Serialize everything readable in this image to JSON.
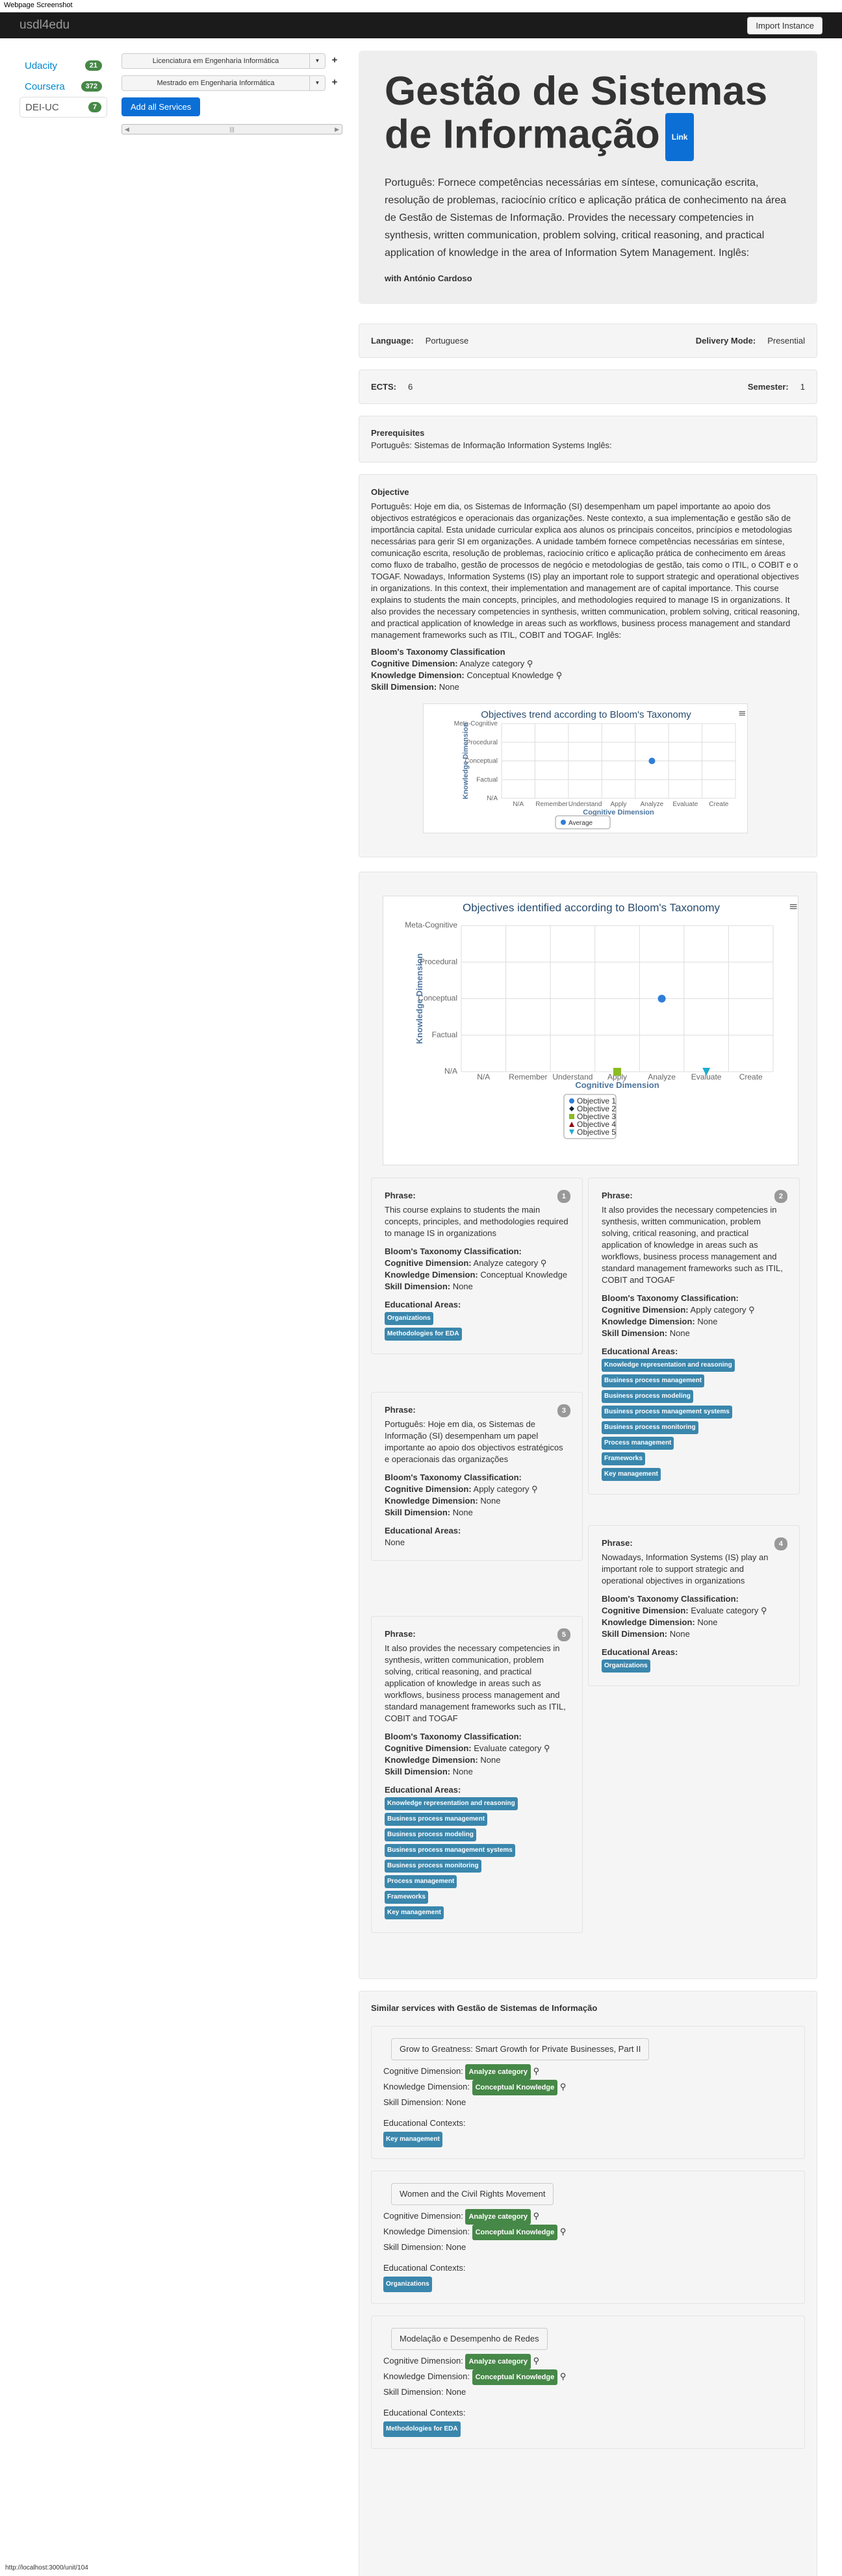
{
  "caption": "Webpage Screenshot",
  "nav": {
    "brand": "usdl4edu",
    "import": "Import Instance"
  },
  "sources": [
    {
      "label": "Udacity",
      "count": "21"
    },
    {
      "label": "Coursera",
      "count": "372"
    },
    {
      "label": "DEI-UC",
      "count": "7"
    }
  ],
  "services": [
    "Licenciatura em Engenharia Informática",
    "Mestrado em Engenharia Informática"
  ],
  "add_all": "Add all Services",
  "hero": {
    "title": "Gestão de Sistemas de Informação",
    "link": "Link",
    "desc": "Português: Fornece competências necessárias em síntese, comunicação escrita, resolução de problemas, raciocínio crítico e aplicação prática de conhecimento na área de Gestão de Sistemas de Informação. Provides the necessary competencies in synthesis, written communication, problem solving, critical reasoning, and practical application of knowledge in the area of Information Sytem Management. Inglês:",
    "with": "with António Cardoso"
  },
  "info": {
    "language_label": "Language:",
    "language": "Portuguese",
    "delivery_label": "Delivery Mode:",
    "delivery": "Presential",
    "ects_label": "ECTS:",
    "ects": "6",
    "semester_label": "Semester:",
    "semester": "1"
  },
  "prereq": {
    "title": "Prerequisites",
    "text": "Português: Sistemas de Informação Information Systems Inglês:"
  },
  "objective": {
    "title": "Objective",
    "text": "Português: Hoje em dia, os Sistemas de Informação (SI) desempenham um papel importante ao apoio dos objectivos estratégicos e operacionais das organizações. Neste contexto, a sua implementação e gestão são de importância capital. Esta unidade curricular explica aos alunos os principais conceitos, princípios e metodologias necessárias para gerir SI em organizações. A unidade também fornece competências necessárias em síntese, comunicação escrita, resolução de problemas, raciocínio crítico e aplicação prática de conhecimento em áreas como fluxo de trabalho, gestão de processos de negócio e metodologias de gestão, tais como o ITIL, o COBIT e o TOGAF. Nowadays, Information Systems (IS) play an important role to support strategic and operational objectives in organizations. In this context, their implementation and management are of capital importance. This course explains to students the main concepts, principles, and methodologies required to manage IS in organizations. It also provides the necessary competencies in synthesis, written communication, problem solving, critical reasoning, and practical application of knowledge in areas such as workflows, business process management and standard management frameworks such as ITIL, COBIT and TOGAF. Inglês:",
    "bloom_title": "Bloom's Taxonomy Classification",
    "cog_label": "Cognitive Dimension:",
    "cog": "Analyze category",
    "know_label": "Knowledge Dimension:",
    "know": "Conceptual Knowledge",
    "skill_label": "Skill Dimension:",
    "skill": "None"
  },
  "chart_data": [
    {
      "type": "scatter",
      "title": "Objectives trend according to Bloom's Taxonomy",
      "xlabel": "Cognitive Dimension",
      "ylabel": "Knowledge Dimension",
      "categories": [
        "N/A",
        "Remember",
        "Understand",
        "Apply",
        "Analyze",
        "Evaluate",
        "Create"
      ],
      "ycategories": [
        "N/A",
        "Factual",
        "Conceptual",
        "Procedural",
        "Meta-Cognitive"
      ],
      "series": [
        {
          "name": "Average",
          "points": [
            [
              "Analyze",
              "Conceptual"
            ]
          ],
          "color": "#2f7ed8",
          "marker": "circle"
        }
      ]
    },
    {
      "type": "scatter",
      "title": "Objectives identified according to Bloom's Taxonomy",
      "xlabel": "Cognitive Dimension",
      "ylabel": "Knowledge Dimension",
      "categories": [
        "N/A",
        "Remember",
        "Understand",
        "Apply",
        "Analyze",
        "Evaluate",
        "Create"
      ],
      "ycategories": [
        "N/A",
        "Factual",
        "Conceptual",
        "Procedural",
        "Meta-Cognitive"
      ],
      "series": [
        {
          "name": "Objective 1",
          "points": [
            [
              "Analyze",
              "Conceptual"
            ]
          ],
          "color": "#2f7ed8",
          "marker": "circle"
        },
        {
          "name": "Objective 2",
          "points": [],
          "color": "#0d233a",
          "marker": "diamond"
        },
        {
          "name": "Objective 3",
          "points": [
            [
              "Apply",
              "N/A"
            ]
          ],
          "color": "#8bbc21",
          "marker": "square"
        },
        {
          "name": "Objective 4",
          "points": [],
          "color": "#910000",
          "marker": "triangle"
        },
        {
          "name": "Objective 5",
          "points": [
            [
              "Evaluate",
              "N/A"
            ]
          ],
          "color": "#1aadce",
          "marker": "triangle-down"
        }
      ]
    }
  ],
  "phrases": [
    {
      "num": "1",
      "label": "Phrase:",
      "text": "This course explains to students the main concepts, principles, and methodologies required to manage IS in organizations",
      "bloom": "Bloom's Taxonomy Classification:",
      "cog_label": "Cognitive Dimension:",
      "cog": "Analyze category",
      "know_label": "Knowledge Dimension:",
      "know": "Conceptual Knowledge",
      "skill_label": "Skill Dimension:",
      "skill": "None",
      "areas_label": "Educational Areas:",
      "areas": [
        "Organizations",
        "Methodologies for EDA"
      ]
    },
    {
      "num": "2",
      "label": "Phrase:",
      "text": "It also provides the necessary competencies in synthesis, written communication, problem solving, critical reasoning, and practical application of knowledge in areas such as workflows, business process management and standard management frameworks such as ITIL, COBIT and TOGAF",
      "bloom": "Bloom's Taxonomy Classification:",
      "cog_label": "Cognitive Dimension:",
      "cog": "Apply category",
      "know_label": "Knowledge Dimension:",
      "know": "None",
      "skill_label": "Skill Dimension:",
      "skill": "None",
      "areas_label": "Educational Areas:",
      "areas": [
        "Knowledge representation and reasoning",
        "Business process management",
        "Business process modeling",
        "Business process management systems",
        "Business process monitoring",
        "Process management",
        "Frameworks",
        "Key management"
      ]
    },
    {
      "num": "3",
      "label": "Phrase:",
      "text": "Português: Hoje em dia, os Sistemas de Informação (SI) desempenham um papel importante ao apoio dos objectivos estratégicos e operacionais das organizações",
      "bloom": "Bloom's Taxonomy Classification:",
      "cog_label": "Cognitive Dimension:",
      "cog": "Apply category",
      "know_label": "Knowledge Dimension:",
      "know": "None",
      "skill_label": "Skill Dimension:",
      "skill": "None",
      "areas_label": "Educational Areas:",
      "areas_text": "None",
      "areas": []
    },
    {
      "num": "4",
      "label": "Phrase:",
      "text": "Nowadays, Information Systems (IS) play an important role to support strategic and operational objectives in organizations",
      "bloom": "Bloom's Taxonomy Classification:",
      "cog_label": "Cognitive Dimension:",
      "cog": "Evaluate category",
      "know_label": "Knowledge Dimension:",
      "know": "None",
      "skill_label": "Skill Dimension:",
      "skill": "None",
      "areas_label": "Educational Areas:",
      "areas": [
        "Organizations"
      ]
    },
    {
      "num": "5",
      "label": "Phrase:",
      "text": "It also provides the necessary competencies in synthesis, written communication, problem solving, critical reasoning, and practical application of knowledge in areas such as workflows, business process management and standard management frameworks such as ITIL, COBIT and TOGAF",
      "bloom": "Bloom's Taxonomy Classification:",
      "cog_label": "Cognitive Dimension:",
      "cog": "Evaluate category",
      "know_label": "Knowledge Dimension:",
      "know": "None",
      "skill_label": "Skill Dimension:",
      "skill": "None",
      "areas_label": "Educational Areas:",
      "areas": [
        "Knowledge representation and reasoning",
        "Business process management",
        "Business process modeling",
        "Business process management systems",
        "Business process monitoring",
        "Process management",
        "Frameworks",
        "Key management"
      ]
    }
  ],
  "similar": {
    "title": "Similar services with Gestão de Sistemas de Informação",
    "cog_label": "Cognitive Dimension:",
    "know_label": "Knowledge Dimension:",
    "skill_label": "Skill Dimension:",
    "ctx_label": "Educational Contexts:",
    "items": [
      {
        "name": "Grow to Greatness: Smart Growth for Private Businesses, Part II",
        "cog": "Analyze category",
        "know": "Conceptual Knowledge",
        "skill": "None",
        "ctx": "Key management"
      },
      {
        "name": "Women and the Civil Rights Movement",
        "cog": "Analyze category",
        "know": "Conceptual Knowledge",
        "skill": "None",
        "ctx": "Organizations"
      },
      {
        "name": "Modelação e Desempenho de Redes",
        "cog": "Analyze category",
        "know": "Conceptual Knowledge",
        "skill": "None",
        "ctx": "Methodologies for EDA"
      }
    ]
  },
  "url": "http://localhost:3000/unit/104"
}
